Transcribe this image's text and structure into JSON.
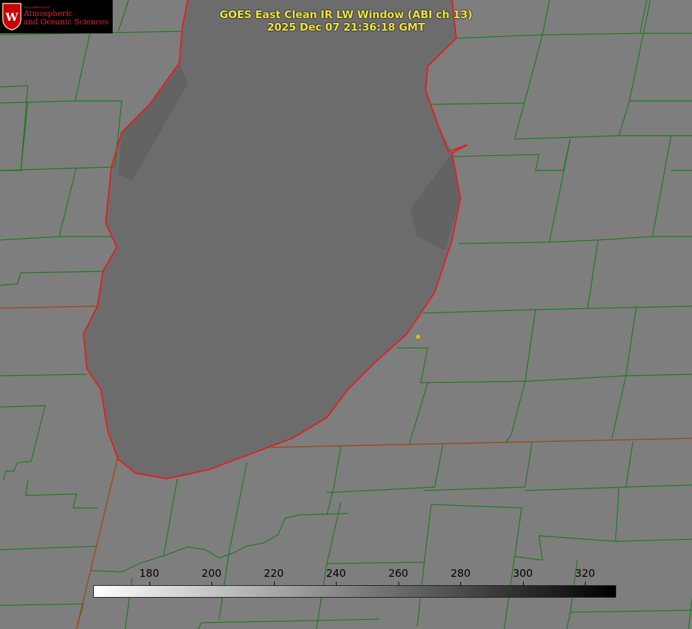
{
  "title": {
    "line1": "GOES East Clean IR LW Window (ABI ch 13)",
    "line2": "2025 Dec 07 21:36:18 GMT"
  },
  "logo": {
    "dept": "Department of",
    "line1": "Atmospheric",
    "line2": "and Oceanic Sciences",
    "crest_letter": "W"
  },
  "colorbar": {
    "ticks": [
      180,
      200,
      220,
      240,
      260,
      280,
      300,
      320
    ],
    "range": [
      162,
      330
    ],
    "gradient": [
      "#ffffff",
      "#000000"
    ]
  },
  "colors": {
    "background": "#7d7d7d",
    "lake": "#6b6b6b",
    "boundaries": "#1a7a1a",
    "coastline": "#e02020",
    "state_line": "#a04a1a",
    "title": "#f0e443",
    "station_marker": "#d6c200"
  },
  "map": {
    "features": [
      "lake-outline",
      "county-boundaries",
      "state-boundary",
      "station-marker"
    ]
  }
}
